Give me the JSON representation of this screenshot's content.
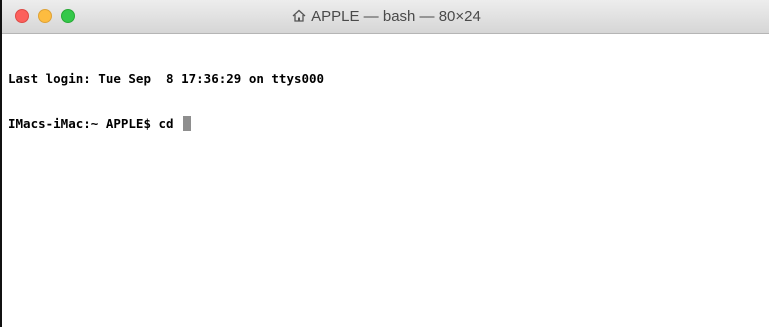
{
  "window": {
    "title": "APPLE — bash — 80×24",
    "title_icon": "home-icon"
  },
  "terminal": {
    "lines": [
      "Last login: Tue Sep  8 17:36:29 on ttys000",
      "IMacs-iMac:~ APPLE$ cd "
    ],
    "cursor_style": "block"
  },
  "colors": {
    "close": "#fc605c",
    "minimize": "#fdbc40",
    "zoom": "#34c84a",
    "titlebar": "#e0e0e0",
    "cursor": "#8e8e8e"
  }
}
